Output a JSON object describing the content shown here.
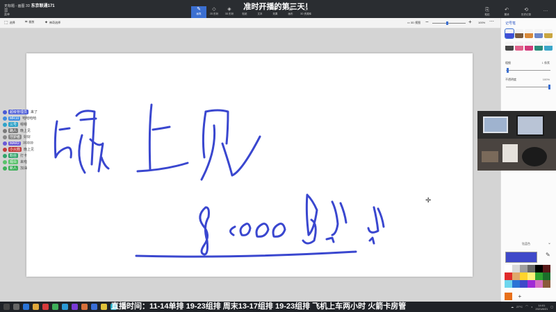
{
  "stream": {
    "overlay_title": "准时开播的第三天！",
    "schedule_text": "直播时间：11-14单排 19-23组排 周末13-17组排 19-23组排 飞机上车两小时 火箭卡房管",
    "tag_prefix": "无标题 - 画图 3D",
    "tag_highlight": "东京联通171"
  },
  "menu": {
    "icon": "menu-icon",
    "label": "菜单"
  },
  "tabs": [
    {
      "label": "画笔",
      "icon": "brush-icon",
      "active": true
    },
    {
      "label": "2D 形状",
      "icon": "shape-2d-icon",
      "active": false
    },
    {
      "label": "3D 形状",
      "icon": "shape-3d-icon",
      "active": false
    },
    {
      "label": "贴纸",
      "icon": "sticker-icon",
      "active": false
    },
    {
      "label": "文本",
      "icon": "text-icon",
      "active": false
    },
    {
      "label": "效果",
      "icon": "effects-icon",
      "active": false
    },
    {
      "label": "画布",
      "icon": "canvas-icon",
      "active": false
    },
    {
      "label": "3D 资源库",
      "icon": "library-icon",
      "active": false
    }
  ],
  "right_menu": [
    {
      "label": "粘贴",
      "icon": "paste-icon"
    },
    {
      "label": "撤消",
      "icon": "undo-icon"
    },
    {
      "label": "历史记录",
      "icon": "history-icon"
    },
    {
      "label": "…",
      "icon": "more-icon"
    }
  ],
  "toolbar": {
    "select": "选择",
    "crop": "裁剪",
    "magic_select": "神奇选择"
  },
  "view": {
    "mode_label": "3D 视图",
    "zoom_value": "100%",
    "zoom_fraction": 0.45
  },
  "brush_panel": {
    "title": "记号笔",
    "thickness_label": "粗细",
    "thickness_value": "1 像素",
    "thickness_fraction": 0.02,
    "opacity_label": "不透明度",
    "opacity_value": "100%",
    "opacity_fraction": 1.0,
    "brushes": [
      {
        "name": "marker-brush",
        "color": "#3f4fd6"
      },
      {
        "name": "calligraphy-pen-brush",
        "color": "#7a5a3c"
      },
      {
        "name": "oil-brush",
        "color": "#d98a3a"
      },
      {
        "name": "watercolor-brush",
        "color": "#6b86c9"
      },
      {
        "name": "pixel-pen-brush",
        "color": "#c9a640"
      },
      {
        "name": "pencil-brush",
        "color": "#444444"
      },
      {
        "name": "eraser-brush",
        "color": "#e0608a"
      },
      {
        "name": "crayon-brush",
        "color": "#d13b7a"
      },
      {
        "name": "spray-can-brush",
        "color": "#2a8c7a"
      },
      {
        "name": "fill-brush",
        "color": "#3aa6c9"
      }
    ],
    "selected_color_label": "钴蓝色",
    "selected_color": "#3f49c9",
    "palette": [
      "#ffffff",
      "#d9d9d9",
      "#9e9e9e",
      "#666666",
      "#000000",
      "#5a1a1a",
      "#e02b2b",
      "#e0a86a",
      "#ffd42b",
      "#fff27a",
      "#2fa32f",
      "#1b6e2a",
      "#6ed6ee",
      "#2b74d6",
      "#3f49c9",
      "#a02bd6",
      "#d670c2",
      "#8a5a3a"
    ],
    "custom_color": "#e8701a",
    "add_color_symbol": "+"
  },
  "chat": [
    {
      "user": "超级管理员",
      "msg": "来了",
      "color": "#4a5ad6"
    },
    {
      "user": "MR10",
      "msg": "哈哈哈哈",
      "color": "#3f8de0"
    },
    {
      "user": "三号",
      "msg": "嗯嗯",
      "color": "#2fa3c9"
    },
    {
      "user": "路人",
      "msg": "晚上见",
      "color": "#7a7a7a"
    },
    {
      "user": "守护者",
      "msg": "好好",
      "color": "#888888"
    },
    {
      "user": "MAR2",
      "msg": "冲冲冲",
      "color": "#6b5ad6"
    },
    {
      "user": "小火箭",
      "msg": "晚上见",
      "color": "#c23b3b"
    },
    {
      "user": "粉丝",
      "msg": "打卡",
      "color": "#2fa36b"
    },
    {
      "user": "观众",
      "msg": "来啦",
      "color": "#5ac26b"
    },
    {
      "user": "新人",
      "msg": "加油",
      "color": "#3fb05a"
    }
  ],
  "taskbar": {
    "temperature": "27°C",
    "time": "14:01",
    "date": "2021/8/21",
    "apps": [
      "#444444",
      "#666666",
      "#2b74d6",
      "#e0a83a",
      "#d63b3b",
      "#3fb05a",
      "#2b9ad6",
      "#7a3ad6",
      "#d6703a",
      "#3a6ed6",
      "#e0c23a",
      "#2ab0c9"
    ]
  },
  "canvas": {
    "ink_color": "#3a47cf",
    "line1": "晚上见",
    "line2": "8 : 00 𝄞𝄞𝄞"
  }
}
